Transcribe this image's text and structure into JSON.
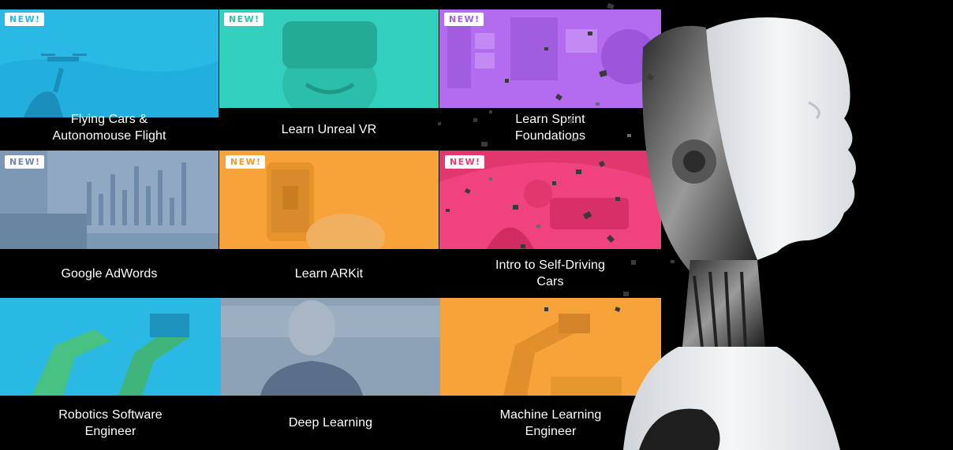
{
  "badge_text": "NEW!",
  "courses": [
    {
      "title": "Flying Cars &\nAutonomouse Flight",
      "new": true,
      "color": "#2ab8e4",
      "badge_color": "#2ab8e4",
      "icon": "drone-pilot-icon"
    },
    {
      "title": "Learn Unreal VR",
      "new": true,
      "color": "#33d1bd",
      "badge_color": "#33bfa8",
      "icon": "vr-headset-icon"
    },
    {
      "title": "Learn Sprint\nFoundations",
      "new": true,
      "color": "#b36cf0",
      "badge_color": "#a260e8",
      "icon": "sprint-board-icon"
    },
    {
      "title": "Google AdWords",
      "new": true,
      "color": "#7d98b5",
      "badge_color": "#6f88a8",
      "icon": "analytics-chart-icon"
    },
    {
      "title": "Learn ARKit",
      "new": true,
      "color": "#f7a33a",
      "badge_color": "#f29a2e",
      "icon": "phone-ar-icon"
    },
    {
      "title": "Intro to Self-Driving\nCars",
      "new": true,
      "color": "#f0427e",
      "badge_color": "#e83c78",
      "icon": "car-dashboard-icon"
    },
    {
      "title": "Robotics Software\nEngineer",
      "new": false,
      "color": "#2ab8e4",
      "badge_color": "#2ab8e4",
      "icon": "robot-arm-icon"
    },
    {
      "title": "Deep Learning",
      "new": false,
      "color": "#8ea2b7",
      "badge_color": "#8ea2b7",
      "icon": "instructor-portrait-icon"
    },
    {
      "title": "Machine Learning\nEngineer",
      "new": false,
      "color": "#f7a33a",
      "badge_color": "#f7a33a",
      "icon": "industrial-robot-icon"
    }
  ],
  "hero_icon": "humanoid-robot-head-icon"
}
